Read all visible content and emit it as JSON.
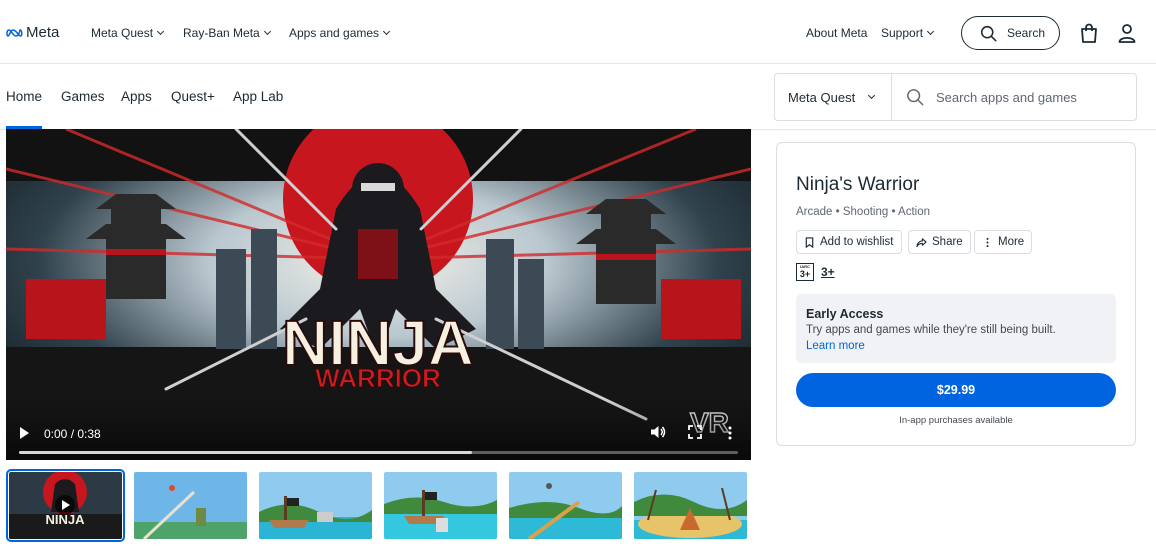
{
  "topnav": {
    "brand": "Meta",
    "items": [
      {
        "label": "Meta Quest"
      },
      {
        "label": "Ray-Ban Meta"
      },
      {
        "label": "Apps and games"
      }
    ],
    "about": "About Meta",
    "support": "Support",
    "search_label": "Search"
  },
  "subnav": {
    "tabs": [
      "Home",
      "Games",
      "Apps",
      "Quest+",
      "App Lab"
    ],
    "active_tab": "Home",
    "store_select": "Meta Quest",
    "search_placeholder": "Search apps and games"
  },
  "video": {
    "title_line1": "NINJA",
    "title_line2": "WARRIOR",
    "time": "0:00 / 0:38",
    "buffered_fraction": 0.63,
    "watermark": "VR",
    "thumb_text": "NINJA"
  },
  "product": {
    "title": "Ninja's Warrior",
    "genres": "Arcade • Shooting • Action",
    "wishlist": "Add to wishlist",
    "share": "Share",
    "more": "More",
    "rating_org": "IARC",
    "rating_badge": "3+",
    "rating_text": "3+",
    "early_access_title": "Early Access",
    "early_access_desc": "Try apps and games while they're still being built.",
    "learn_more": "Learn more",
    "price": "$29.99",
    "iap_note": "In-app purchases available"
  },
  "colors": {
    "accent": "#0064e0",
    "text": "#1c2b33",
    "border": "#dadde1",
    "panel": "#f0f2f5"
  }
}
